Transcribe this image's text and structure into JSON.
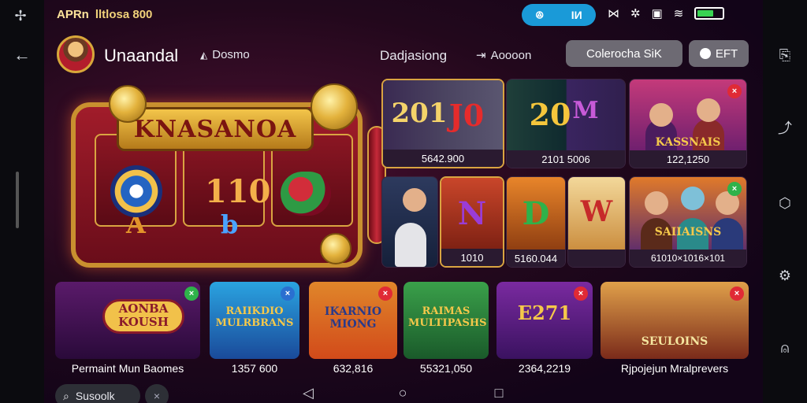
{
  "status_bar": {
    "left_a": "APRn",
    "left_b": "lltlosa 800",
    "pill_a": "ꔮ",
    "pill_b": "IИ",
    "icons": [
      "signal-icon",
      "settings-icon",
      "screen-icon",
      "wifi-icon",
      "battery-icon"
    ],
    "battery_level": 0.65
  },
  "header": {
    "title": "Unaandal",
    "tab_a": "Dosmo",
    "tab_b": "Dadjasiong",
    "tab_c": "Aoooon",
    "button_a": "Coleroсha SiK",
    "button_b": "EFT"
  },
  "featured": {
    "banner": "KNASANOA",
    "num_a": "110",
    "num_b": "b",
    "letter": "A"
  },
  "grid": {
    "row1": [
      {
        "big": "201",
        "cap": "5642.900",
        "span": true
      },
      {
        "big": "J0",
        "cap": ""
      },
      {
        "big": "20",
        "cap": "2101 5006"
      },
      {
        "big": "M",
        "cap": ""
      },
      {
        "big": "KASSNAIS",
        "cap": "122,1250",
        "badge": "×"
      }
    ],
    "row2": [
      {
        "big": "N",
        "cap": "1010"
      },
      {
        "big": "D",
        "cap": "5160.044"
      },
      {
        "big": "W",
        "cap": ""
      },
      {
        "big": "SAIIAISNS",
        "cap": "61010×1016×101",
        "badge": "×"
      }
    ]
  },
  "cards": [
    {
      "title": "AONBA KOUSH",
      "label": "Permaint Mun Baomes",
      "badge": "×"
    },
    {
      "title": "RAIIKDIO MULRBRANS",
      "label": "1357 600",
      "badge": "×"
    },
    {
      "title": "IKARNIO MIONG",
      "label": "632,816",
      "badge": "×"
    },
    {
      "title": "RAIMAS MULTIPASHS",
      "label": "55321,050",
      "badge": "×"
    },
    {
      "title": "E271",
      "label": "2364,2219",
      "badge": "×"
    },
    {
      "title": "SEULOINS",
      "label": "Rjpojejun Mralprevers",
      "badge": "×"
    }
  ],
  "bottom": {
    "search_label": "Susoolk",
    "close_label": "×"
  },
  "colors": {
    "accent_blue": "#1a9ad8",
    "gold": "#d9a441",
    "bg": "#22081c"
  }
}
